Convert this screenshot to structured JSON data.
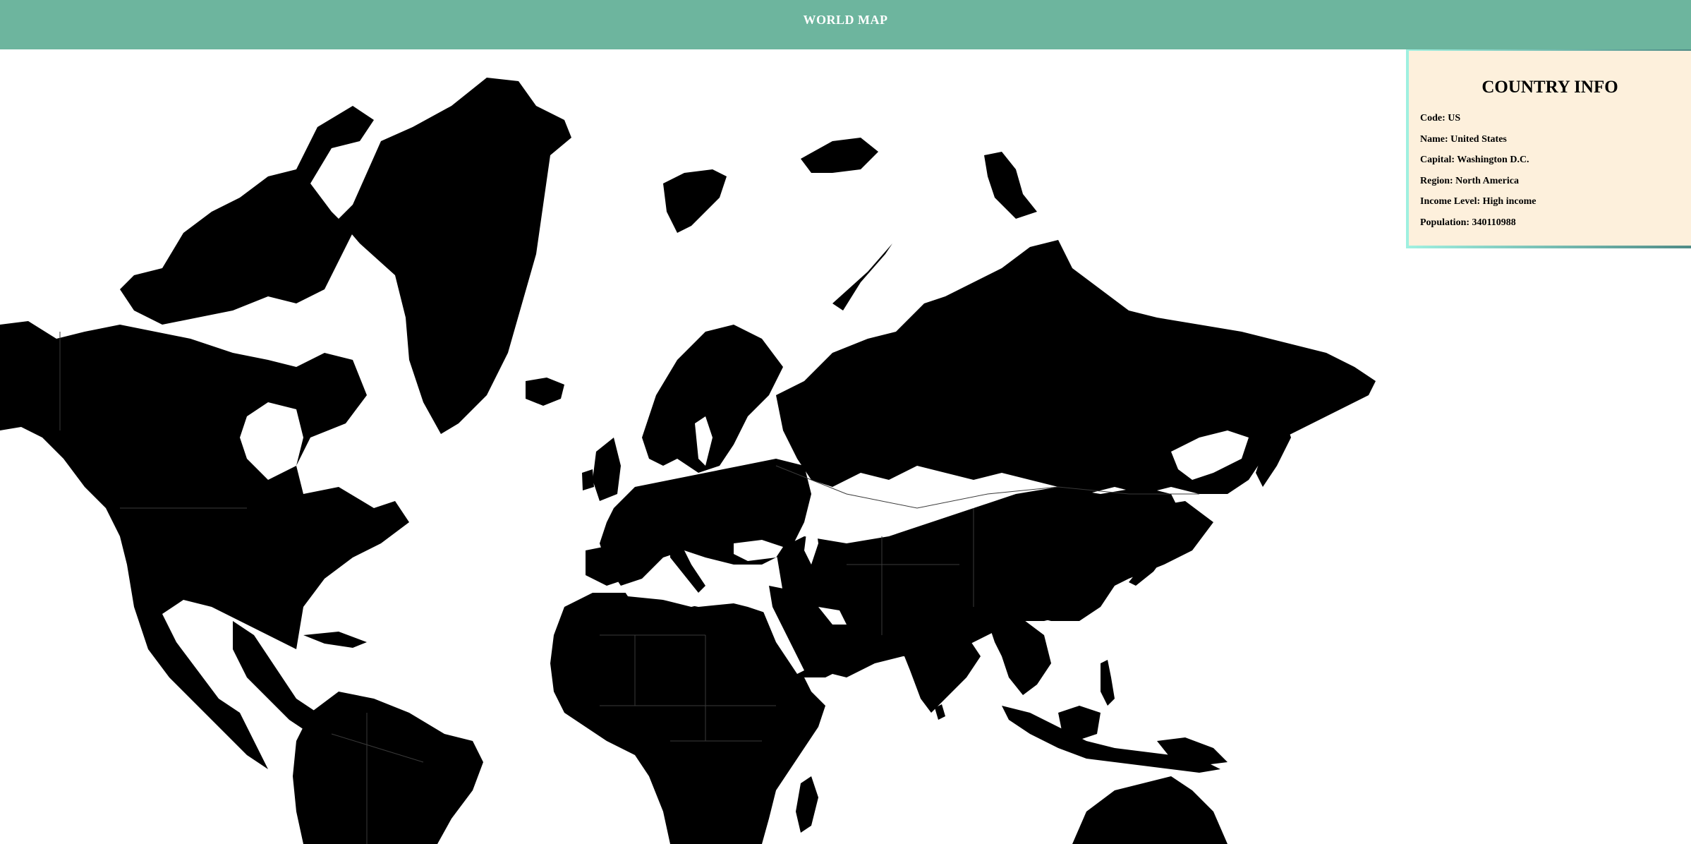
{
  "header": {
    "title": "WORLD MAP"
  },
  "map": {
    "land_color": "#000000",
    "ocean_color": "#ffffff",
    "border_color": "#3a3a3a"
  },
  "info_panel": {
    "title": "COUNTRY INFO",
    "background": "#fdf0dc",
    "rows": [
      {
        "label": "Code",
        "value": "US",
        "text": "Code: US"
      },
      {
        "label": "Name",
        "value": "United States",
        "text": "Name: United States"
      },
      {
        "label": "Capital",
        "value": "Washington D.C.",
        "text": "Capital: Washington D.C."
      },
      {
        "label": "Region",
        "value": "North America",
        "text": "Region: North America"
      },
      {
        "label": "Income Level",
        "value": "High income",
        "text": "Income Level: High income"
      },
      {
        "label": "Population",
        "value": "340110988",
        "text": "Population: 340110988"
      }
    ]
  },
  "colors": {
    "header_bg": "#6db59e",
    "header_text": "#ffffff",
    "panel_border": "#5e9e96"
  }
}
